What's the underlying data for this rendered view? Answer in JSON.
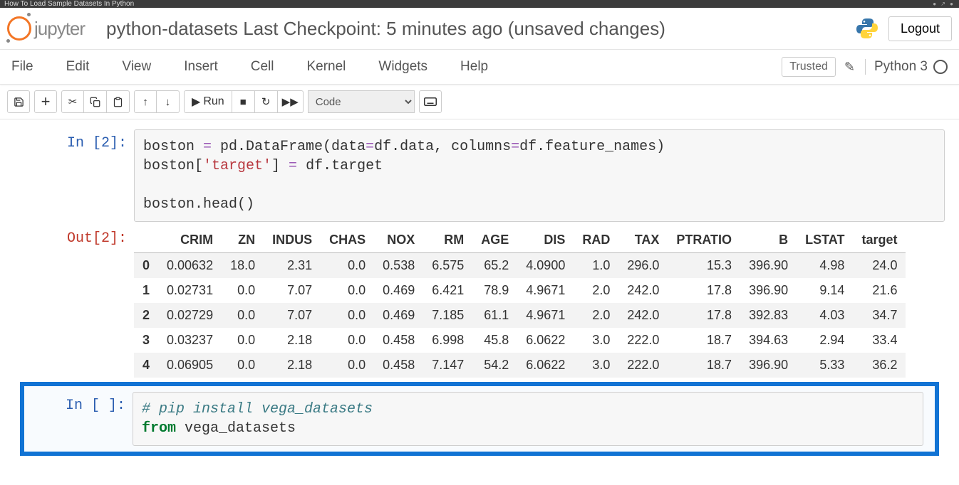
{
  "browser_tab": "How To Load Sample Datasets In Python",
  "logo_text": "jupyter",
  "doc_title": "python-datasets Last Checkpoint: 5 minutes ago  (unsaved changes)",
  "logout": "Logout",
  "menus": [
    "File",
    "Edit",
    "View",
    "Insert",
    "Cell",
    "Kernel",
    "Widgets",
    "Help"
  ],
  "trusted": "Trusted",
  "kernel": "Python 3",
  "toolbar": {
    "run": "Run",
    "celltype": "Code"
  },
  "cells": {
    "in2_prompt": "In [2]:",
    "out2_prompt": "Out[2]:",
    "in_blank_prompt": "In [ ]:",
    "code2": {
      "line1a": "boston ",
      "line1b": "=",
      "line1c": " pd.DataFrame(data",
      "line1d": "=",
      "line1e": "df.data, columns",
      "line1f": "=",
      "line1g": "df.feature_names)",
      "line2a": "boston[",
      "line2b": "'target'",
      "line2c": "] ",
      "line2d": "=",
      "line2e": " df.target",
      "line3": "boston.head()"
    },
    "code3": {
      "l1": "# pip install vega_datasets",
      "l2a": "from",
      "l2b": " vega_datasets"
    }
  },
  "chart_data": {
    "type": "table",
    "columns": [
      "CRIM",
      "ZN",
      "INDUS",
      "CHAS",
      "NOX",
      "RM",
      "AGE",
      "DIS",
      "RAD",
      "TAX",
      "PTRATIO",
      "B",
      "LSTAT",
      "target"
    ],
    "index": [
      "0",
      "1",
      "2",
      "3",
      "4"
    ],
    "rows": [
      [
        "0.00632",
        "18.0",
        "2.31",
        "0.0",
        "0.538",
        "6.575",
        "65.2",
        "4.0900",
        "1.0",
        "296.0",
        "15.3",
        "396.90",
        "4.98",
        "24.0"
      ],
      [
        "0.02731",
        "0.0",
        "7.07",
        "0.0",
        "0.469",
        "6.421",
        "78.9",
        "4.9671",
        "2.0",
        "242.0",
        "17.8",
        "396.90",
        "9.14",
        "21.6"
      ],
      [
        "0.02729",
        "0.0",
        "7.07",
        "0.0",
        "0.469",
        "7.185",
        "61.1",
        "4.9671",
        "2.0",
        "242.0",
        "17.8",
        "392.83",
        "4.03",
        "34.7"
      ],
      [
        "0.03237",
        "0.0",
        "2.18",
        "0.0",
        "0.458",
        "6.998",
        "45.8",
        "6.0622",
        "3.0",
        "222.0",
        "18.7",
        "394.63",
        "2.94",
        "33.4"
      ],
      [
        "0.06905",
        "0.0",
        "2.18",
        "0.0",
        "0.458",
        "7.147",
        "54.2",
        "6.0622",
        "3.0",
        "222.0",
        "18.7",
        "396.90",
        "5.33",
        "36.2"
      ]
    ]
  }
}
